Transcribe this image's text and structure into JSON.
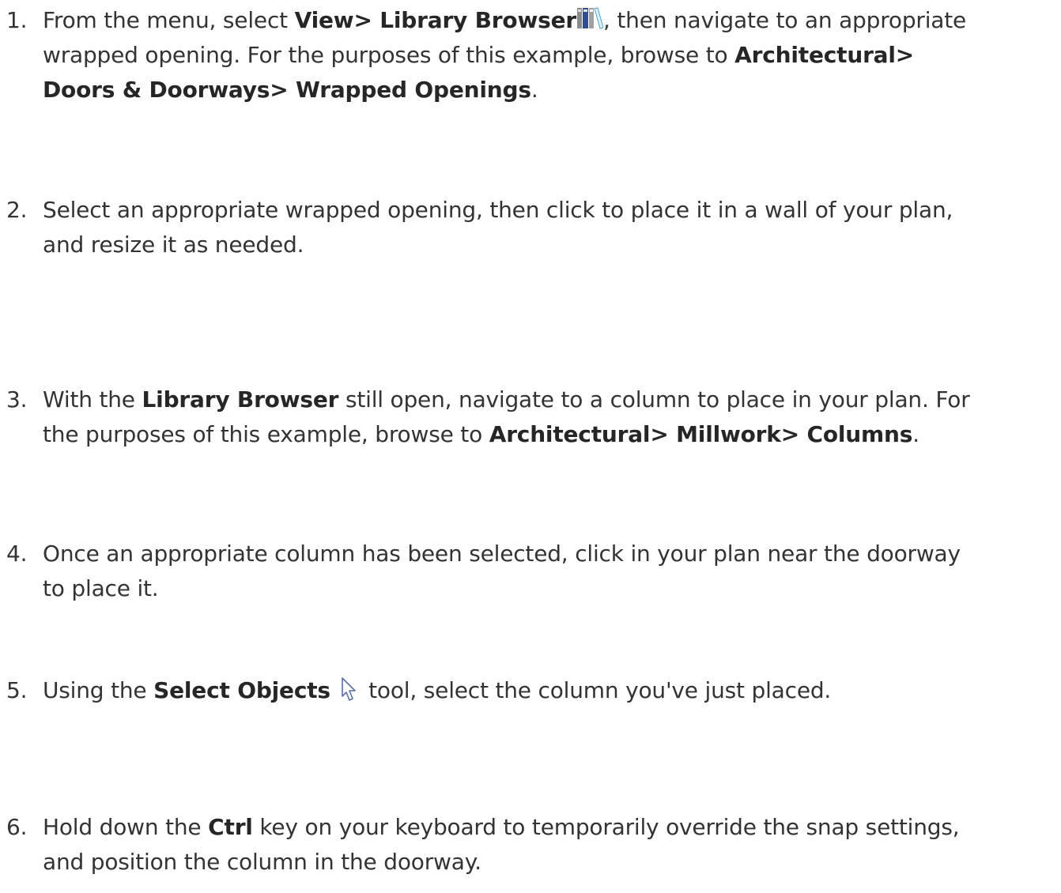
{
  "steps": [
    {
      "number": "1.",
      "lines": [
        [
          {
            "t": "From the menu, select "
          },
          {
            "b": "View> Library Browser"
          },
          {
            "icon": "library-browser-icon"
          },
          {
            "t": ", then navigate to an appropriate"
          }
        ],
        [
          {
            "t": "wrapped opening. For the purposes of this example, browse to "
          },
          {
            "b": "Architectural>"
          }
        ],
        [
          {
            "b": "Doors & Doorways> Wrapped Openings"
          },
          {
            "t": "."
          }
        ]
      ]
    },
    {
      "number": "2.",
      "lines": [
        [
          {
            "t": "Select an appropriate wrapped opening, then click to place it in a wall of your plan,"
          }
        ],
        [
          {
            "t": "and resize it as needed."
          }
        ]
      ]
    },
    {
      "number": "3.",
      "lines": [
        [
          {
            "t": "With the "
          },
          {
            "b": "Library Browser"
          },
          {
            "t": " still open, navigate to a column to place in your plan. For"
          }
        ],
        [
          {
            "t": "the purposes of this example, browse to "
          },
          {
            "b": "Architectural> Millwork> Columns"
          },
          {
            "t": "."
          }
        ]
      ]
    },
    {
      "number": "4.",
      "lines": [
        [
          {
            "t": "Once an appropriate column has been selected, click in your plan near the doorway"
          }
        ],
        [
          {
            "t": "to place it."
          }
        ]
      ]
    },
    {
      "number": "5.",
      "lines": [
        [
          {
            "t": "Using the "
          },
          {
            "b": "Select Objects "
          },
          {
            "icon": "select-objects-arrow-icon"
          },
          {
            "t": " tool, select the column you've just placed."
          }
        ]
      ]
    },
    {
      "number": "6.",
      "lines": [
        [
          {
            "t": "Hold down the "
          },
          {
            "b": "Ctrl"
          },
          {
            "t": " key on your keyboard to temporarily override the snap settings,"
          }
        ],
        [
          {
            "t": "and position the column in the doorway."
          }
        ]
      ]
    }
  ]
}
